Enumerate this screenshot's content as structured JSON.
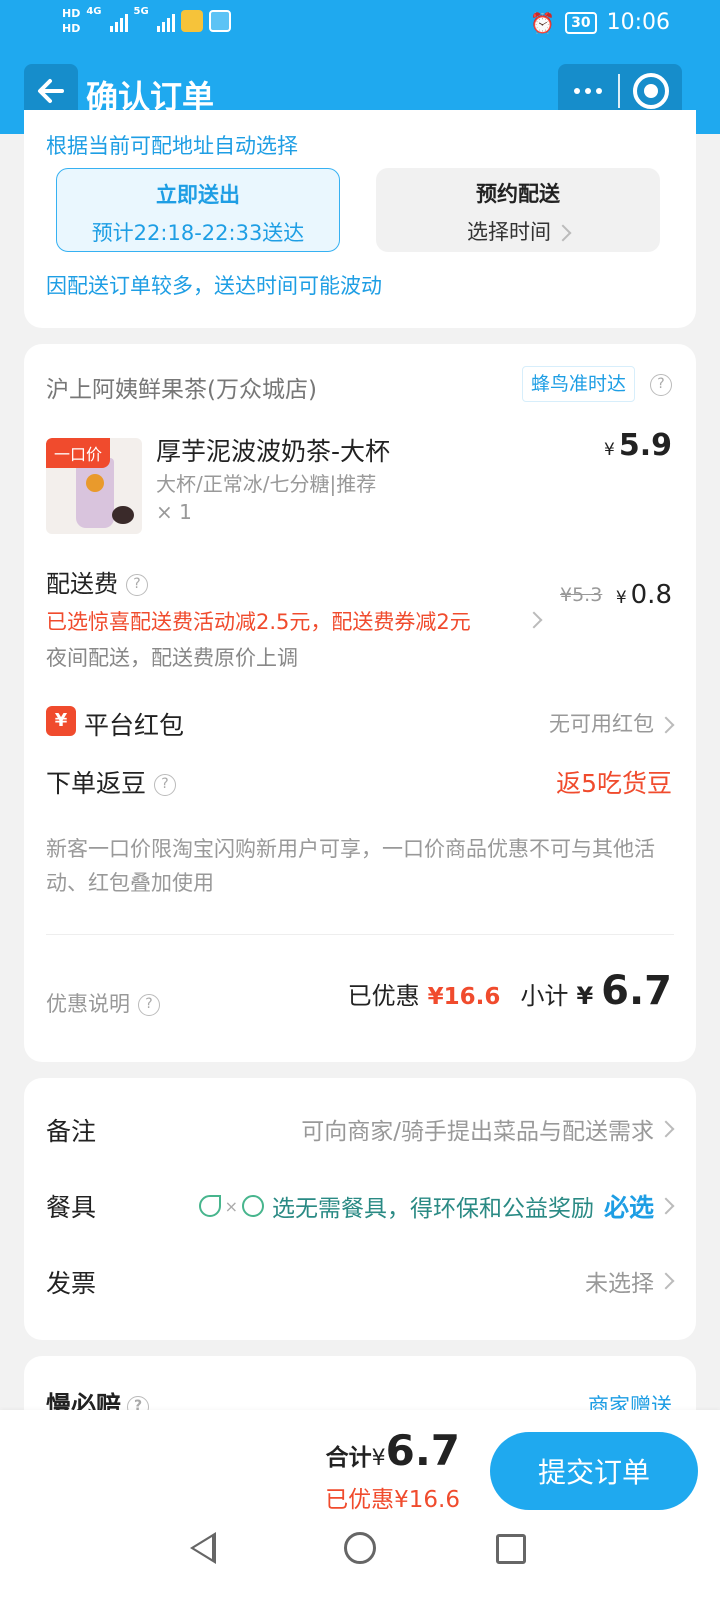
{
  "status_bar": {
    "hd1": "HD",
    "hd2": "HD",
    "net1": "4G",
    "net2": "5G",
    "battery": "30",
    "time": "10:06"
  },
  "header": {
    "title": "确认订单"
  },
  "delivery": {
    "auto_note": "根据当前可配地址自动选择",
    "now_title": "立即送出",
    "now_sub": "预计22:18-22:33送达",
    "later_title": "预约配送",
    "later_sub": "选择时间",
    "notice": "因配送订单较多，送达时间可能波动"
  },
  "order": {
    "shop_name": "沪上阿姨鲜果茶(万众城店)",
    "shop_tag": "蜂鸟准时达",
    "product": {
      "badge": "一口价",
      "name": "厚芋泥波波奶茶-大杯",
      "spec": "大杯/正常冰/七分糖|推荐",
      "qty": "× 1",
      "currency": "¥",
      "price": "5.9"
    },
    "delivery_fee": {
      "label": "配送费",
      "promo": "已选惊喜配送费活动减2.5元，配送费券减2元",
      "night_note": "夜间配送，配送费原价上调",
      "original": "¥5.3",
      "currency": "¥",
      "price": "0.8"
    },
    "red_packet": {
      "icon": "¥",
      "label": "平台红包",
      "value": "无可用红包"
    },
    "beans": {
      "label": "下单返豆",
      "value": "返5吃货豆"
    },
    "new_customer_note": "新客一口价限淘宝闪购新用户可享，一口价商品优惠不可与其他活动、红包叠加使用",
    "discount_label": "优惠说明",
    "saved_label": "已优惠",
    "saved_value": "¥16.6",
    "subtotal_label": "小计",
    "subtotal_currency": "¥",
    "subtotal_value": "6.7"
  },
  "extras": {
    "remarks_label": "备注",
    "remarks_value": "可向商家/骑手提出菜品与配送需求",
    "tableware_label": "餐具",
    "tableware_value": "选无需餐具，得环保和公益奖励",
    "tableware_must": "必选",
    "invoice_label": "发票",
    "invoice_value": "未选择"
  },
  "partial_card": {
    "title": "慢必赔",
    "right": "商家赠送"
  },
  "bottom_bar": {
    "total_label": "合计",
    "currency": "¥",
    "total_value": "6.7",
    "saved": "已优惠¥16.6",
    "submit": "提交订单"
  },
  "icons": {
    "back": "arrow-left-icon",
    "more": "more-dots-icon",
    "close": "target-close-icon",
    "help": "question-circle-icon",
    "chevron": "chevron-right-icon",
    "leaf": "leaf-icon",
    "clock": "alarm-clock-icon"
  },
  "colors": {
    "brand_blue": "#1fa9ef",
    "accent_red": "#f04b2d",
    "eco_green": "#2a8a84"
  }
}
